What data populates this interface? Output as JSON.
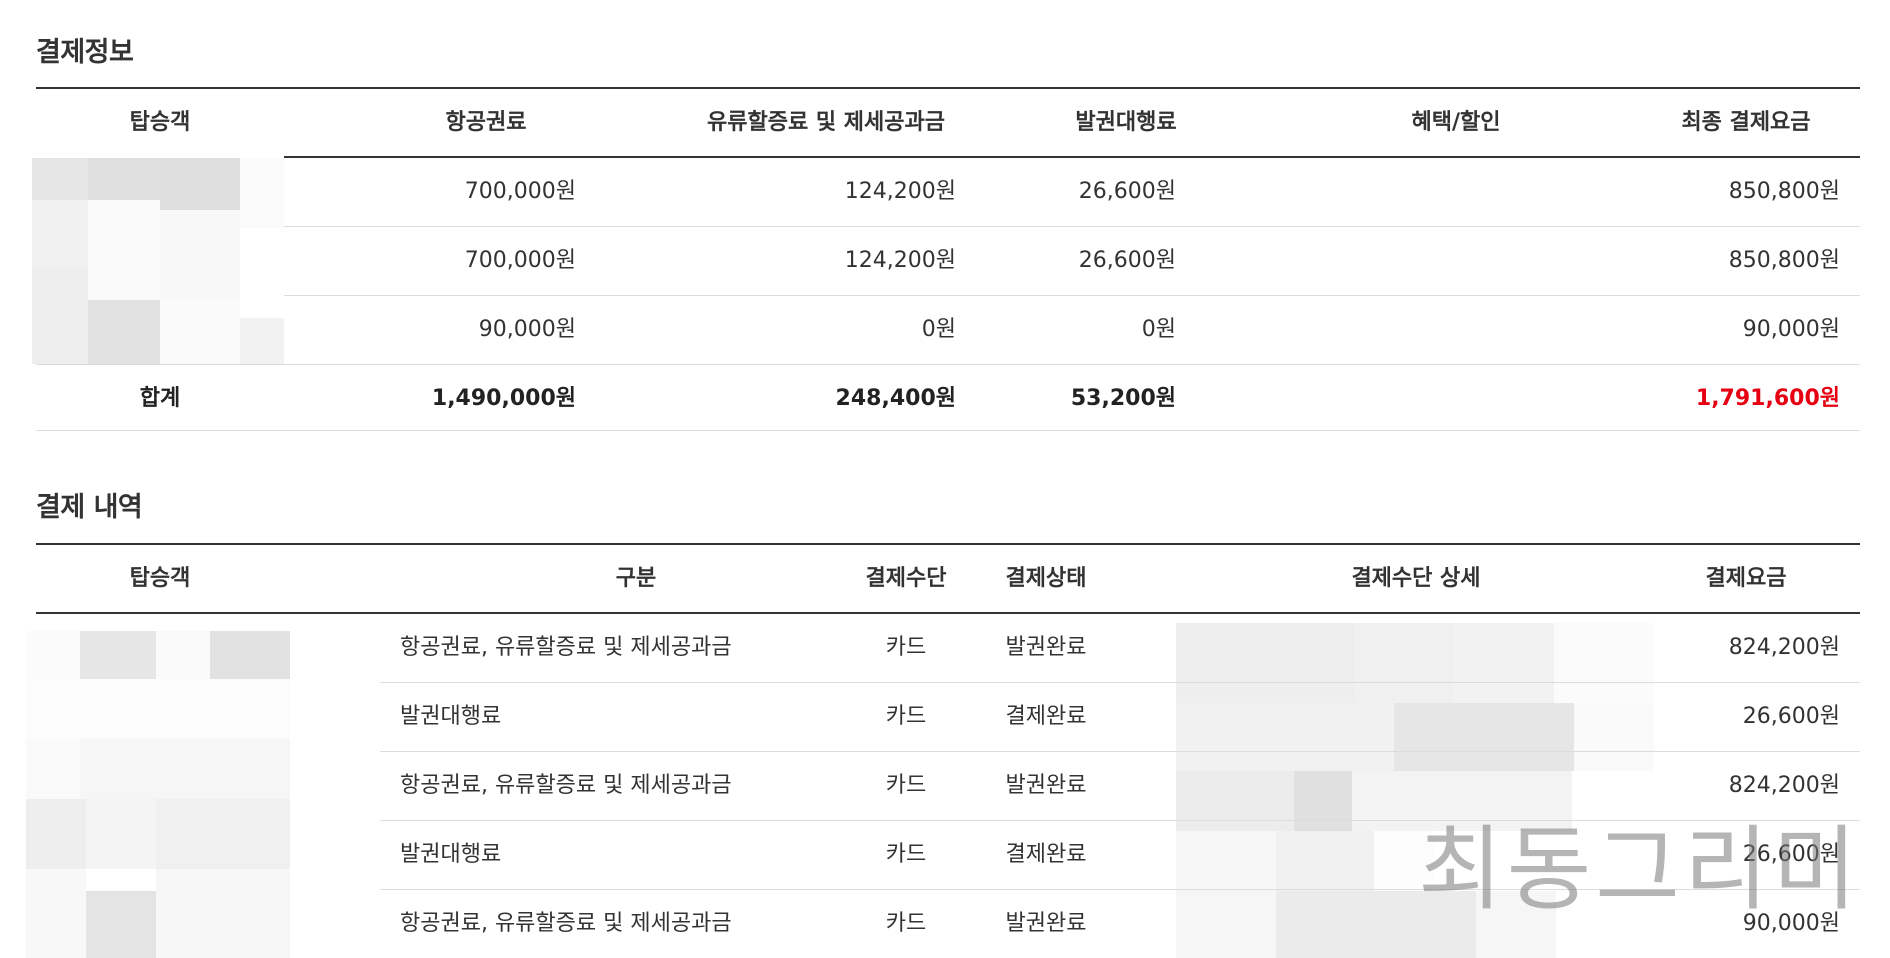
{
  "summary": {
    "title": "결제정보",
    "headers": [
      "탑승객",
      "항공권료",
      "유류할증료 및 제세공과금",
      "발권대행료",
      "혜택/할인",
      "최종 결제요금"
    ],
    "rows": [
      {
        "fare": "700,000원",
        "surcharge": "124,200원",
        "ticketing_fee": "26,600원",
        "discount": "",
        "total": "850,800원"
      },
      {
        "fare": "700,000원",
        "surcharge": "124,200원",
        "ticketing_fee": "26,600원",
        "discount": "",
        "total": "850,800원"
      },
      {
        "fare": "90,000원",
        "surcharge": "0원",
        "ticketing_fee": "0원",
        "discount": "",
        "total": "90,000원"
      }
    ],
    "totals": {
      "label": "합계",
      "fare": "1,490,000원",
      "surcharge": "248,400원",
      "ticketing_fee": "53,200원",
      "discount": "",
      "total": "1,791,600원"
    },
    "total_color": "#e60012"
  },
  "history": {
    "title": "결제 내역",
    "headers": [
      "탑승객",
      "구분",
      "결제수단",
      "결제상태",
      "결제수단 상세",
      "결제요금"
    ],
    "rows": [
      {
        "category": "항공권료, 유류할증료 및 제세공과금",
        "method": "카드",
        "status": "발권완료",
        "amount": "824,200원"
      },
      {
        "category": "발권대행료",
        "method": "카드",
        "status": "결제완료",
        "amount": "26,600원"
      },
      {
        "category": "항공권료, 유류할증료 및 제세공과금",
        "method": "카드",
        "status": "발권완료",
        "amount": "824,200원"
      },
      {
        "category": "발권대행료",
        "method": "카드",
        "status": "결제완료",
        "amount": "26,600원"
      },
      {
        "category": "항공권료, 유류할증료 및 제세공과금",
        "method": "카드",
        "status": "발권완료",
        "amount": "90,000원"
      }
    ]
  },
  "watermark": "최동그리미"
}
